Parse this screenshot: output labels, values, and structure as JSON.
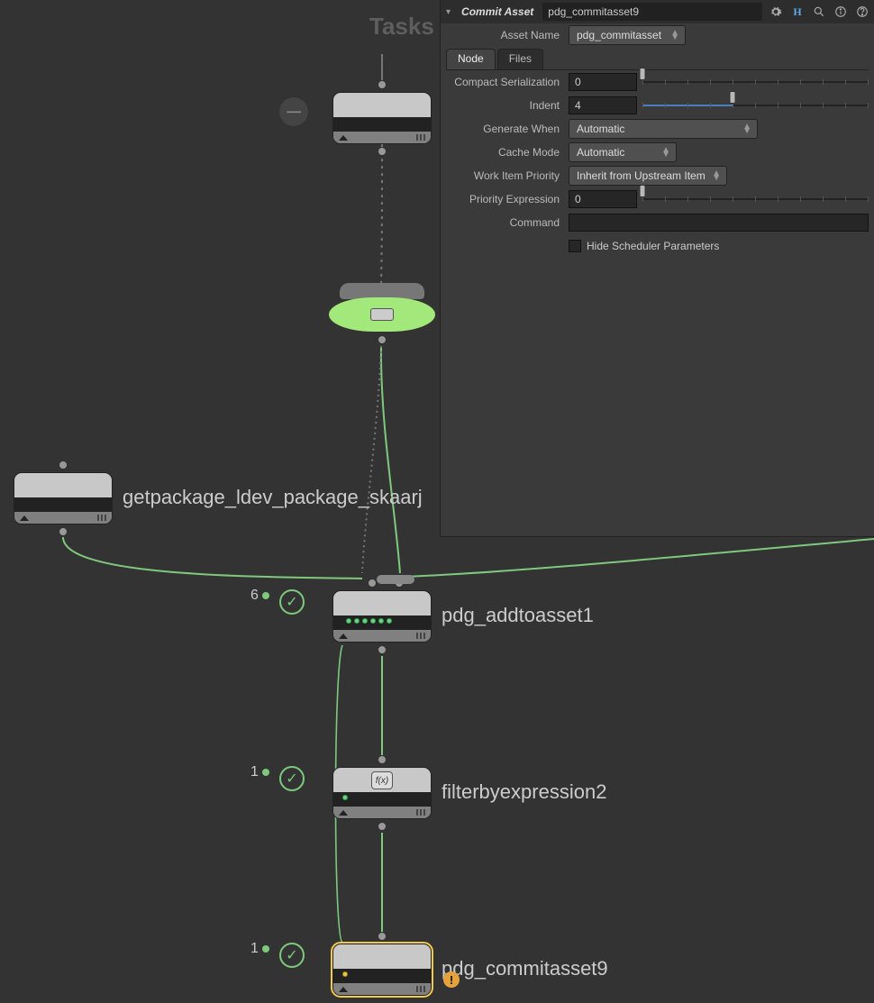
{
  "graph": {
    "title": "Tasks",
    "nodes": {
      "getpackage": {
        "label": "getpackage_ldev_package_skaarj"
      },
      "addtoasset": {
        "label": "pdg_addtoasset1",
        "count": "6"
      },
      "filter": {
        "label": "filterbyexpression2",
        "count": "1"
      },
      "commit": {
        "label": "pdg_commitasset9",
        "count": "1"
      }
    }
  },
  "panel": {
    "operator_type": "Commit Asset",
    "operator_name": "pdg_commitasset9",
    "asset_name_label": "Asset Name",
    "asset_name_value": "pdg_commitasset",
    "tabs": {
      "node": "Node",
      "files": "Files"
    },
    "params": {
      "compact_serialization": {
        "label": "Compact Serialization",
        "value": "0"
      },
      "indent": {
        "label": "Indent",
        "value": "4"
      },
      "generate_when": {
        "label": "Generate When",
        "value": "Automatic"
      },
      "cache_mode": {
        "label": "Cache Mode",
        "value": "Automatic"
      },
      "work_item_priority": {
        "label": "Work Item Priority",
        "value": "Inherit from Upstream Item"
      },
      "priority_expression": {
        "label": "Priority Expression",
        "value": "0"
      },
      "command": {
        "label": "Command",
        "value": ""
      },
      "hide_scheduler": {
        "label": "Hide Scheduler Parameters"
      }
    },
    "icons": {
      "gear": "gear",
      "h": "H",
      "search": "search",
      "info": "info",
      "help": "help"
    }
  }
}
